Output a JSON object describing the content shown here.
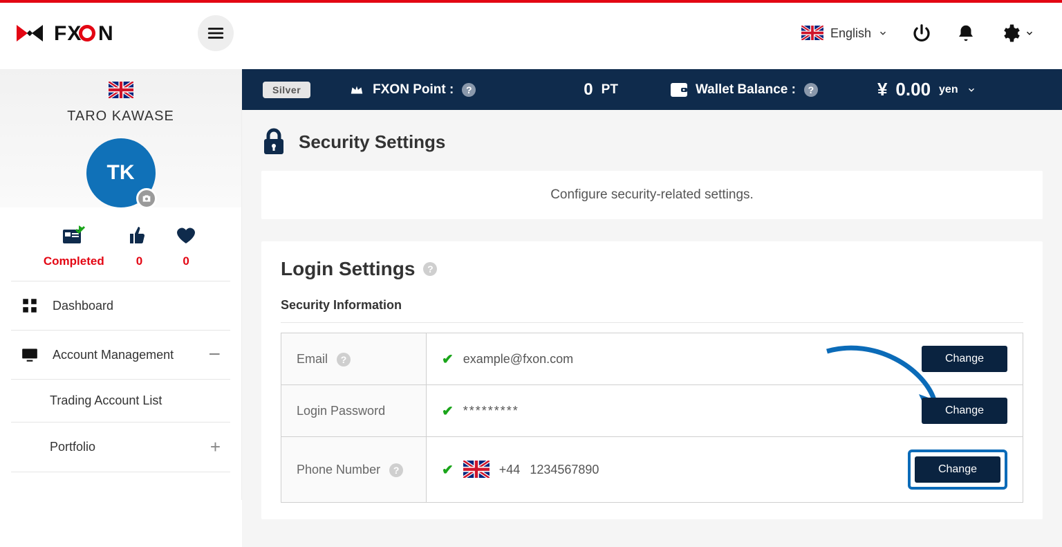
{
  "header": {
    "language_label": "English"
  },
  "ribbon": {
    "tier_badge": "Silver",
    "point_label": "FXON Point :",
    "point_value": "0",
    "point_unit": "PT",
    "wallet_label": "Wallet Balance :",
    "wallet_currency_symbol": "¥",
    "wallet_value": "0.00",
    "wallet_unit": "yen"
  },
  "profile": {
    "name": "TARO KAWASE",
    "initials": "TK",
    "stats": {
      "completed_label": "Completed",
      "likes": "0",
      "favorites": "0"
    }
  },
  "menu": {
    "dashboard": "Dashboard",
    "account_mgmt": "Account Management",
    "trading_list": "Trading Account List",
    "portfolio": "Portfolio"
  },
  "page": {
    "title": "Security Settings",
    "subtitle": "Configure security-related settings.",
    "login_heading": "Login Settings",
    "security_info_heading": "Security Information"
  },
  "rows": {
    "email_label": "Email",
    "email_value": "example@fxon.com",
    "password_label": "Login Password",
    "password_value": "*********",
    "phone_label": "Phone Number",
    "phone_prefix": "+44",
    "phone_value": "1234567890",
    "change_btn": "Change"
  }
}
